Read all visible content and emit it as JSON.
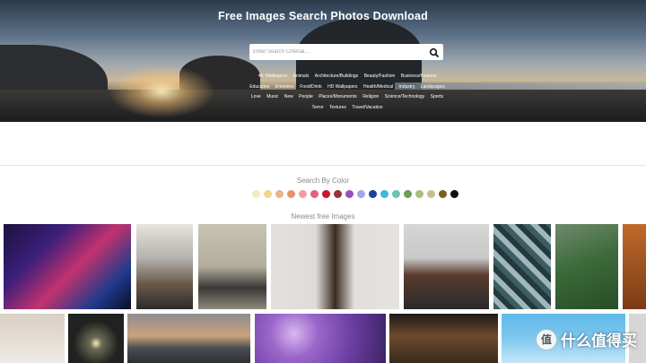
{
  "hero": {
    "title": "Free Images Search Photos Download",
    "search_placeholder": "Enter Search Criterial...",
    "search_icon": "search-icon",
    "tags": [
      "4K Wallpapers",
      "Animals",
      "Architecture/Buildings",
      "Beauty/Fashion",
      "Business/Finance",
      "Education",
      "Emotions",
      "Food/Drink",
      "HD Wallpapers",
      "Health/Medical",
      "Industry",
      "Landscapes",
      "Love",
      "Music",
      "New",
      "People",
      "Places/Monuments",
      "Religion",
      "Science/Technology",
      "Sports",
      "Terror",
      "Textures",
      "Travel/Vacation"
    ]
  },
  "color_section": {
    "title": "Search By Color",
    "colors": [
      "#f4e8c6",
      "#f3d58b",
      "#e9b48a",
      "#e8926e",
      "#f29f9f",
      "#e35f86",
      "#c8162b",
      "#9b2f3c",
      "#9b4fb3",
      "#a4a6e5",
      "#1e3f9e",
      "#3fb8d9",
      "#6cc3b2",
      "#6a9c58",
      "#a7c17c",
      "#c8c089",
      "#7a5d20",
      "#111111"
    ]
  },
  "newest_section": {
    "title": "Newest free Images"
  },
  "watermark": {
    "badge": "值",
    "text": "什么值得买"
  }
}
